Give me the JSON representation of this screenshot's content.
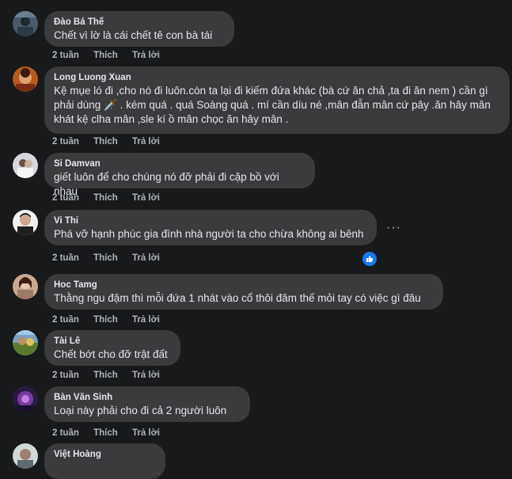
{
  "actions": {
    "time": "2 tuần",
    "like": "Thích",
    "reply": "Trả lời"
  },
  "more_label": "···",
  "comments": [
    {
      "author": "Đào Bá Thế",
      "text": "Chết vì lờ là cái chết tê con bà tái"
    },
    {
      "author": "Long Luong Xuan",
      "text": "Kệ mụe ló đi ,cho nó đi luôn.còn ta lại đi kiếm đứa khác (bà cứ ăn chả ,ta đi ăn nem ) cần gì phải dùng 🗡️ . kém quá . quá Soàng quá . mí cần díu né ,mân đẫn mân cứ pây .ăn hây mân khát kệ clha mân ,sle kí ồ mân chọc ăn hây mân ."
    },
    {
      "author": "Si Damvan",
      "text": "giết luôn để cho chúng nó đỡ phải đi cặp bồ với nhau"
    },
    {
      "author": "Vi Thi",
      "text": "Phá vỡ hạnh phúc gia đình nhà người ta cho chừa không ai bênh"
    },
    {
      "author": "Hoc Tamg",
      "text": "Thằng ngu đậm thì mỗi đứa 1 nhát vào cổ thôi đâm thế mỏi tay có việc gì đâu"
    },
    {
      "author": "Tài Lê",
      "text": "Chết bớt cho đỡ trật đất"
    },
    {
      "author": "Bàn Văn Sinh",
      "text": "Loại này phải cho đi cả 2 người luôn"
    },
    {
      "author": "Việt Hoàng",
      "text": ""
    }
  ],
  "colors": {
    "bubble": "#3a3b3c",
    "background": "#18191a",
    "like_blue": "#1877f2"
  }
}
